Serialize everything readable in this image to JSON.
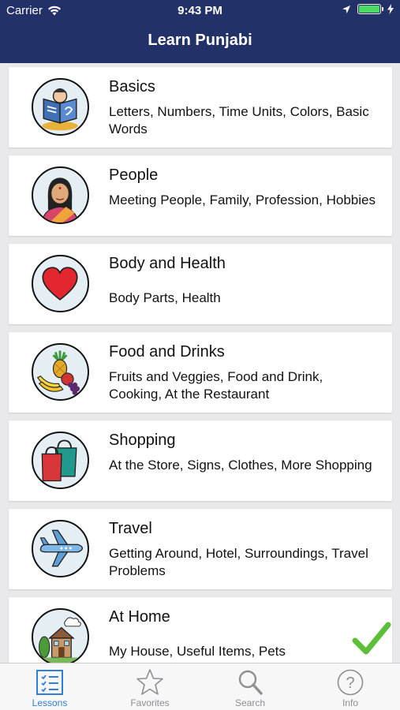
{
  "status_bar": {
    "carrier": "Carrier",
    "time": "9:43 PM",
    "battery_percent": 100
  },
  "nav": {
    "title": "Learn Punjabi"
  },
  "lessons": [
    {
      "title": "Basics",
      "subtitle": "Letters, Numbers, Time Units, Colors, Basic Words",
      "icon": "reading-book-icon"
    },
    {
      "title": "People",
      "subtitle": "Meeting People, Family, Profession, Hobbies",
      "icon": "woman-portrait-icon"
    },
    {
      "title": "Body and Health",
      "subtitle": "Body Parts, Health",
      "icon": "heart-icon"
    },
    {
      "title": "Food and Drinks",
      "subtitle": "Fruits and Veggies, Food and Drink, Cooking, At the Restaurant",
      "icon": "fruits-icon"
    },
    {
      "title": "Shopping",
      "subtitle": "At the Store, Signs, Clothes, More Shopping",
      "icon": "shopping-bags-icon"
    },
    {
      "title": "Travel",
      "subtitle": "Getting Around, Hotel, Surroundings, Travel Problems",
      "icon": "airplane-icon"
    },
    {
      "title": "At Home",
      "subtitle": "My House, Useful Items, Pets",
      "icon": "house-icon",
      "completed": true
    }
  ],
  "tabbar": [
    {
      "label": "Lessons",
      "icon": "lessons-list-icon",
      "active": true
    },
    {
      "label": "Favorites",
      "icon": "star-icon",
      "active": false
    },
    {
      "label": "Search",
      "icon": "search-icon",
      "active": false
    },
    {
      "label": "Info",
      "icon": "info-question-icon",
      "active": false
    }
  ],
  "colors": {
    "nav_bar": "#233169",
    "active_tab": "#2f7fd8",
    "check": "#5bbf3a"
  }
}
